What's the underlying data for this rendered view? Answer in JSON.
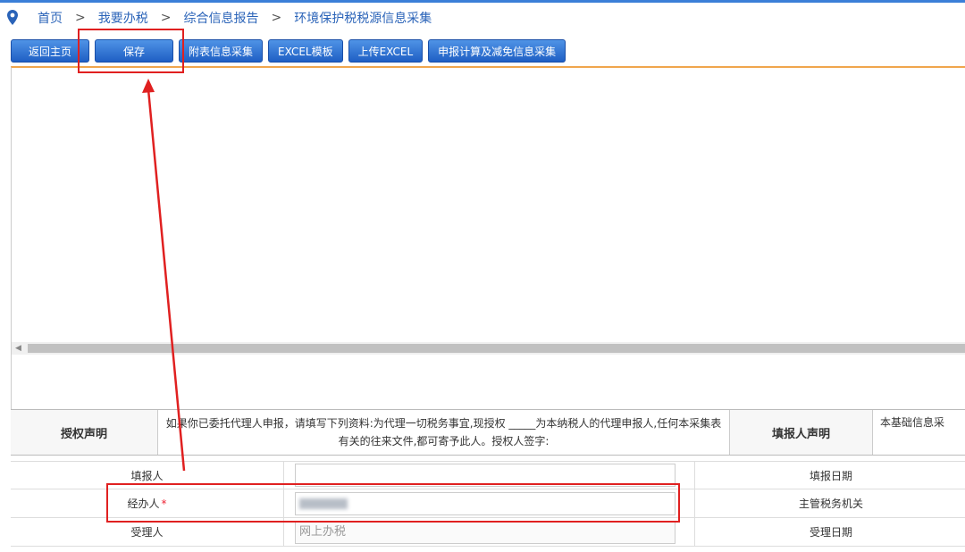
{
  "breadcrumb": [
    "首页",
    "我要办税",
    "综合信息报告",
    "环境保护税税源信息采集"
  ],
  "breadcrumb_separator": ">",
  "toolbar": {
    "back_label": "返回主页",
    "save_label": "保存",
    "attach_label": "附表信息采集",
    "excel_template_label": "EXCEL模板",
    "upload_excel_label": "上传EXCEL",
    "declare_label": "申报计算及减免信息采集"
  },
  "declaration": {
    "auth_title": "授权声明",
    "auth_text": "如果你已委托代理人申报，请填写下列资料:为代理一切税务事宜,现授权 _____为本纳税人的代理申报人,任何本采集表有关的往来文件,都可寄予此人。授权人签字:",
    "filler_title": "填报人声明",
    "filler_text": "本基础信息采"
  },
  "form": {
    "filler_label": "填报人",
    "filler_value": "",
    "handler_label": "经办人",
    "handler_required": "*",
    "receiver_label": "受理人",
    "receiver_value": "网上办税",
    "fill_date_label": "填报日期",
    "tax_authority_label": "主管税务机关",
    "accept_date_label": "受理日期"
  },
  "colors": {
    "accent": "#2a63b8",
    "highlight": "#e02020",
    "content_border": "#f0a64d"
  }
}
